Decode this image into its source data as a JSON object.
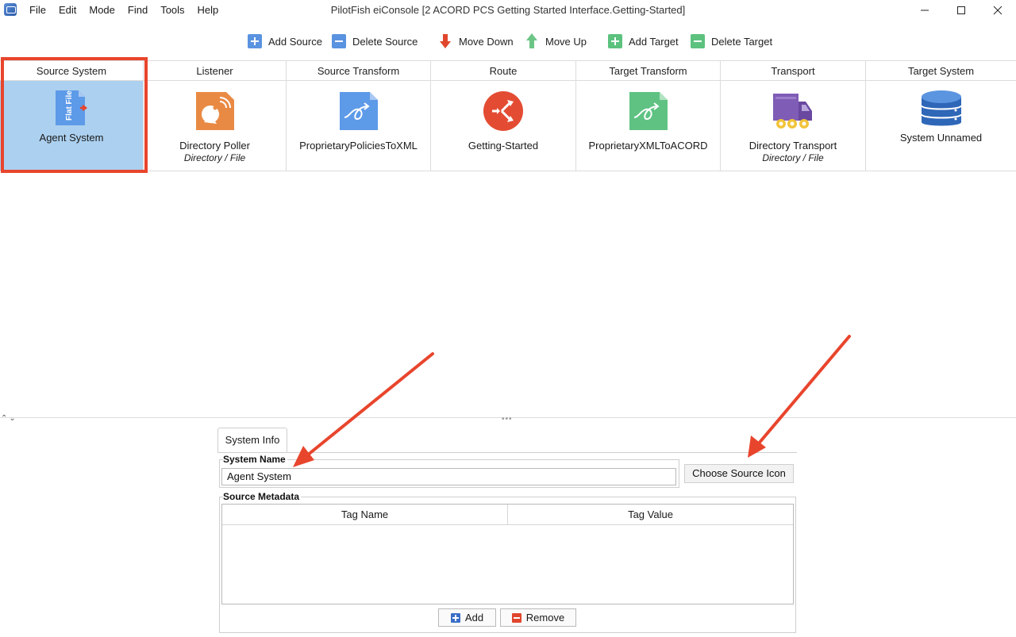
{
  "window": {
    "title": "PilotFish eiConsole [2 ACORD PCS Getting Started Interface.Getting-Started]",
    "menu": [
      "File",
      "Edit",
      "Mode",
      "Find",
      "Tools",
      "Help"
    ],
    "controls": [
      "minimize",
      "maximize",
      "close"
    ]
  },
  "toolbar": {
    "add_source": "Add Source",
    "delete_source": "Delete Source",
    "move_down": "Move Down",
    "move_up": "Move Up",
    "add_target": "Add Target",
    "delete_target": "Delete Target"
  },
  "stages": [
    {
      "header": "Source System",
      "label": "Agent System",
      "sub": "",
      "icon": "flat-file-icon",
      "selected": true
    },
    {
      "header": "Listener",
      "label": "Directory Poller",
      "sub": "Directory / File",
      "icon": "satellite-dish-icon"
    },
    {
      "header": "Source Transform",
      "label": "ProprietaryPoliciesToXML",
      "sub": "",
      "icon": "transform-document-icon"
    },
    {
      "header": "Route",
      "label": "Getting-Started",
      "sub": "",
      "icon": "route-shuffle-icon"
    },
    {
      "header": "Target Transform",
      "label": "ProprietaryXMLToACORD",
      "sub": "",
      "icon": "transform-document-icon"
    },
    {
      "header": "Transport",
      "label": "Directory Transport",
      "sub": "Directory / File",
      "icon": "truck-icon"
    },
    {
      "header": "Target System",
      "label": "System Unnamed",
      "sub": "",
      "icon": "database-icon"
    }
  ],
  "icon_texts": {
    "flat_file": "Flat File"
  },
  "colors": {
    "selection_outline": "#e8452d",
    "selected_bg": "#acd0ef",
    "annotation_arrow": "#e8452d"
  },
  "panel": {
    "tab": "System Info",
    "system_name_label": "System Name",
    "system_name_value": "Agent System",
    "choose_icon": "Choose Source Icon",
    "metadata_label": "Source Metadata",
    "columns": [
      "Tag Name",
      "Tag Value"
    ],
    "add": "Add",
    "remove": "Remove"
  }
}
